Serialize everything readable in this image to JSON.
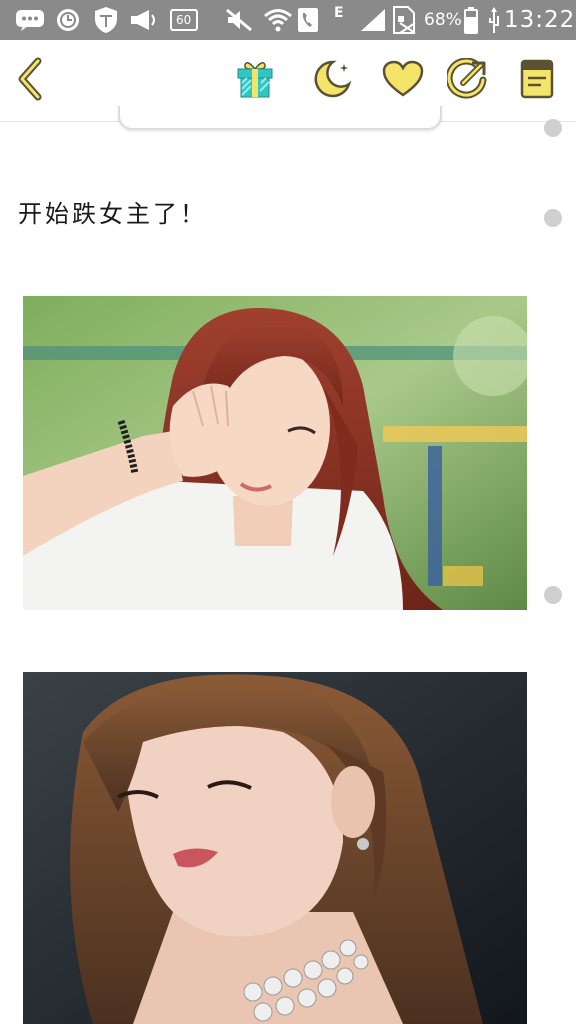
{
  "status_bar": {
    "speed": "60",
    "network": "E",
    "battery": "68%",
    "time": "13:22",
    "icons": [
      "chat-bubble-icon",
      "clock-badge-icon",
      "shield-icon",
      "megaphone-icon",
      "speed-badge-icon",
      "mute-icon",
      "wifi-icon",
      "call-icon",
      "signal-icon",
      "no-sim-icon",
      "battery-icon",
      "usb-icon"
    ]
  },
  "toolbar": {
    "icons": [
      "back-chevron-icon",
      "gift-icon",
      "moon-icon",
      "heart-icon",
      "share-icon",
      "notebook-icon"
    ]
  },
  "post": {
    "text": "开始跌女主了！"
  },
  "photos": [
    {
      "name": "photo-1",
      "description_icon": "photo"
    },
    {
      "name": "photo-2",
      "description_icon": "photo"
    }
  ],
  "colors": {
    "status_bar": "#8a8a8a",
    "accent_yellow": "#f5e46a",
    "outline_dark": "#5b5234",
    "gift_teal": "#2fc7c4",
    "scroll_dot": "#cfcfcf"
  }
}
